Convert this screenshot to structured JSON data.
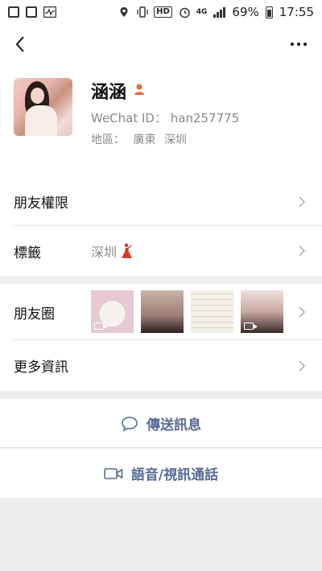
{
  "status_bar": {
    "battery": "69%",
    "time": "17:55",
    "network": "4G",
    "hd": "HD"
  },
  "profile": {
    "name": "涵涵",
    "wechat_id": "WeChat ID： han257775",
    "region_label": "地區：",
    "region_province": "廣東",
    "region_city": "深圳"
  },
  "rows": {
    "friend_permissions": "朋友權限",
    "tags_label": "標籤",
    "tags_value": "深圳",
    "moments_label": "朋友圈",
    "more_info": "更多資訊"
  },
  "actions": {
    "send_message": "傳送訊息",
    "voice_video_call": "語音/視訊通話"
  },
  "colors": {
    "link": "#576b95",
    "gender_badge": "#e56a4a",
    "background": "#ededed"
  }
}
